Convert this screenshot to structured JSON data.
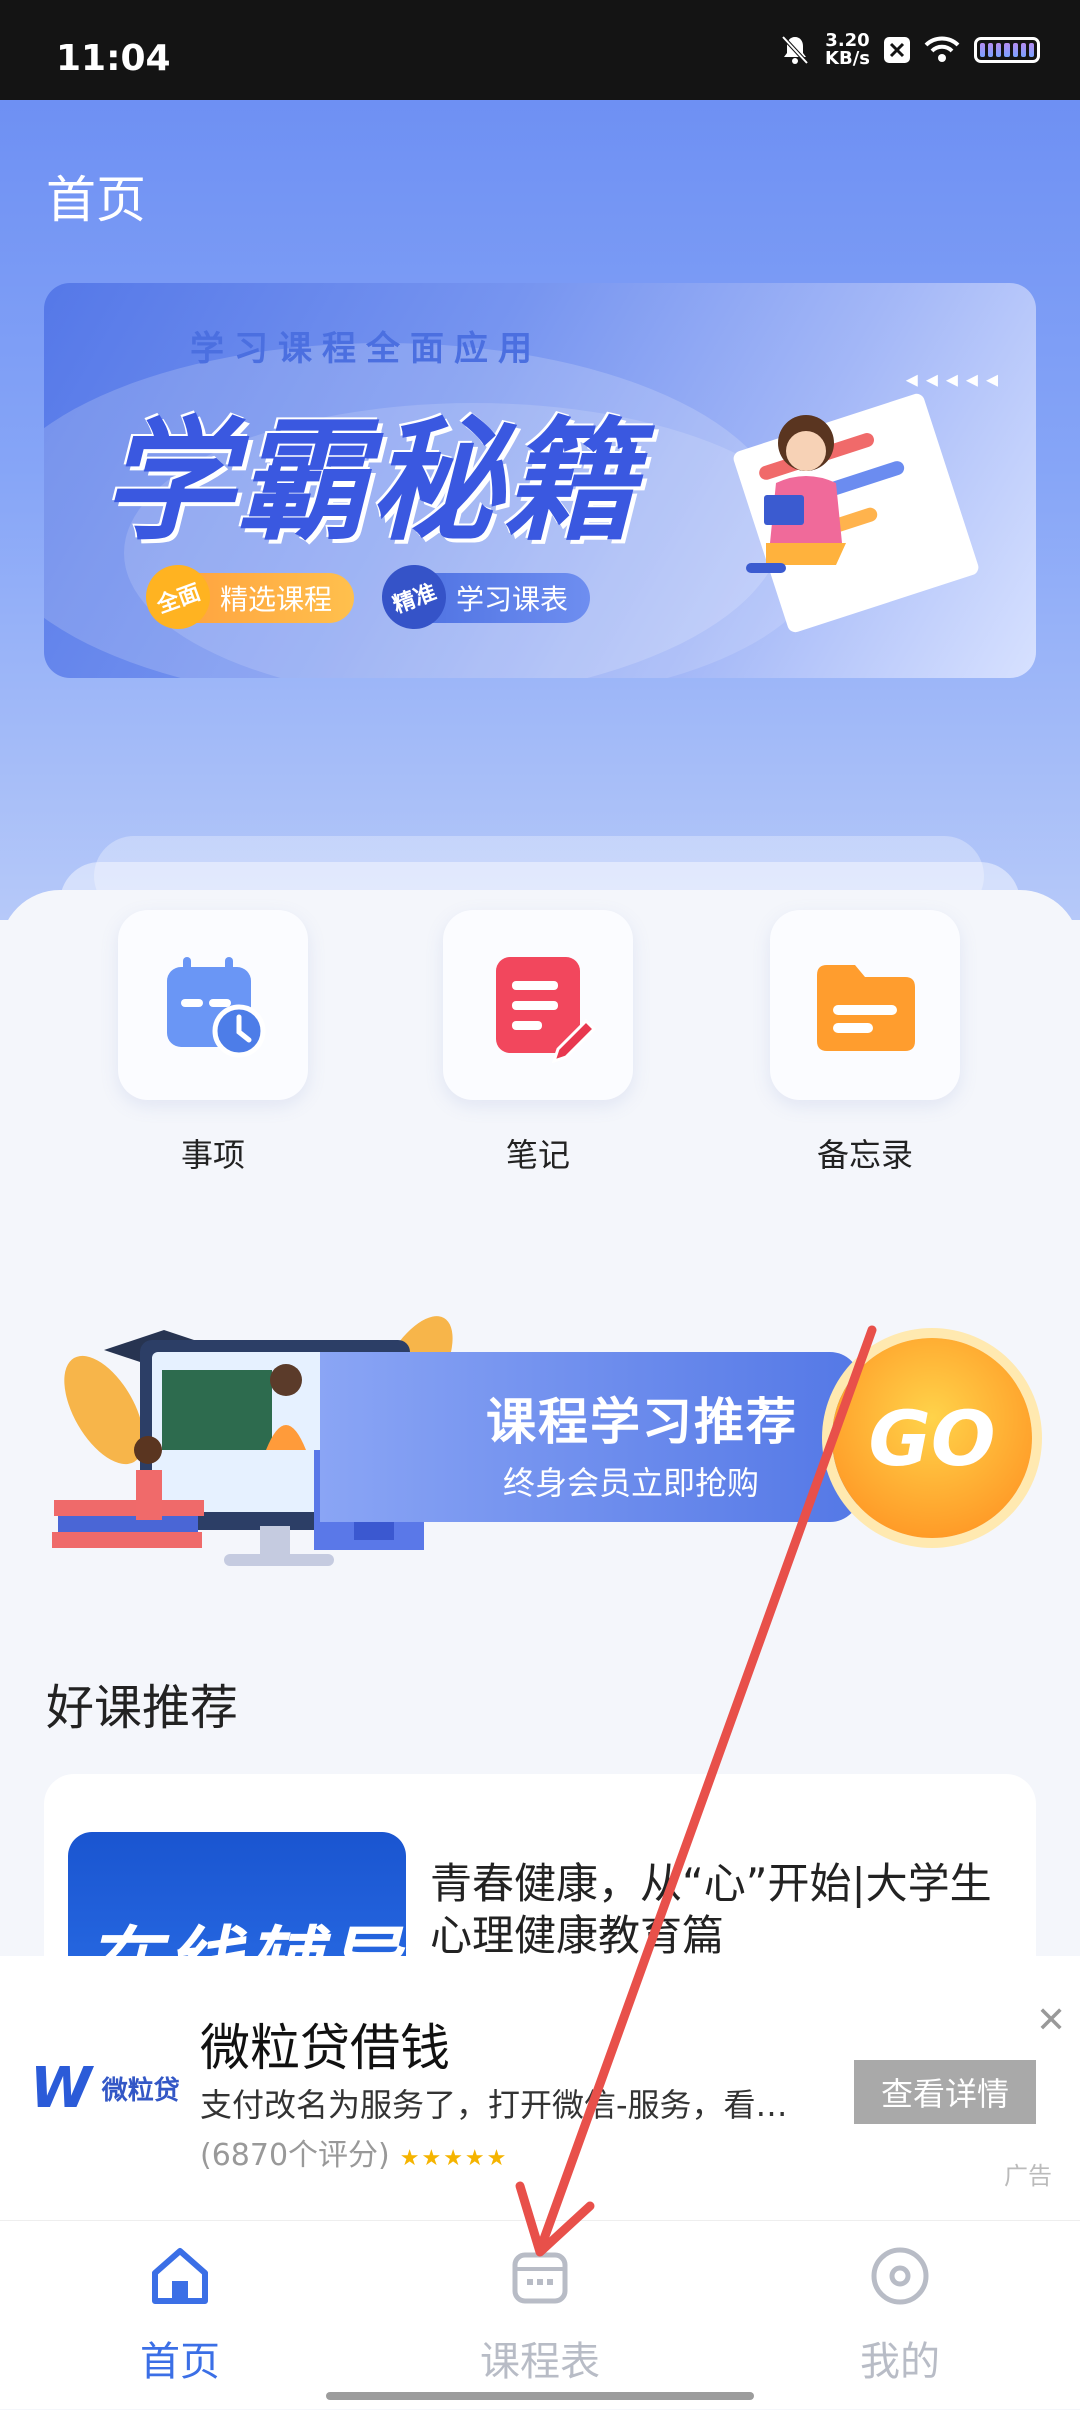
{
  "status_bar": {
    "time": "11:04",
    "net_speed": "3.20",
    "net_unit": "KB/s"
  },
  "header": {
    "title": "首页"
  },
  "banner": {
    "subtitle": "学习课程全面应用",
    "title": "学霸秘籍",
    "tags": [
      {
        "badge": "全面",
        "label": "精选课程"
      },
      {
        "badge": "精准",
        "label": "学习课表"
      }
    ]
  },
  "features": [
    {
      "label": "事项",
      "icon": "calendar-clock-icon",
      "color": "#6a96f5"
    },
    {
      "label": "笔记",
      "icon": "note-icon",
      "color": "#f2475d"
    },
    {
      "label": "备忘录",
      "icon": "folder-icon",
      "color": "#ff9d2e"
    }
  ],
  "promo": {
    "title": "课程学习推荐",
    "subtitle": "终身会员立即抢购",
    "button": "GO"
  },
  "section": {
    "title": "好课推荐"
  },
  "course": {
    "thumb_text": "在线辅导",
    "title": "青春健康，从“心”开始|大学生心理健康教育篇"
  },
  "ad": {
    "brand": "微粒贷",
    "title": "微粒贷借钱",
    "description": "支付改名为服务了，打开微信-服务，看…",
    "rating": "(6870个评分)",
    "stars": "★★★★★",
    "button": "查看详情",
    "label": "广告"
  },
  "tabbar": [
    {
      "label": "首页",
      "active": true
    },
    {
      "label": "课程表",
      "active": false
    },
    {
      "label": "我的",
      "active": false
    }
  ],
  "colors": {
    "accent": "#3b6fe6",
    "inactive": "#b8bcc6",
    "arrow": "#e8504a"
  }
}
